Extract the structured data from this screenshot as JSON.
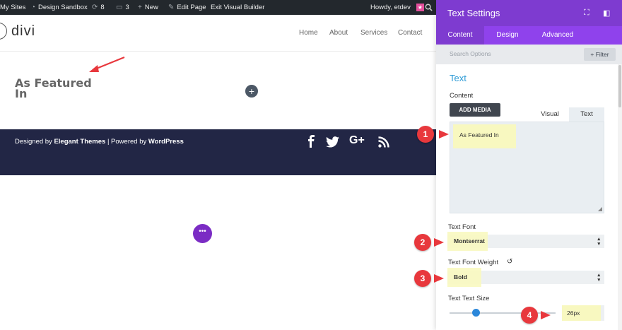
{
  "admin_bar": {
    "my_sites": "My Sites",
    "site_name": "Design Sandbox",
    "updates_count": "8",
    "comments_count": "3",
    "new_label": "New",
    "edit_page": "Edit Page",
    "exit_builder": "Exit Visual Builder",
    "howdy": "Howdy, etdev"
  },
  "site": {
    "logo_text": "divi",
    "nav": [
      "Home",
      "About",
      "Services",
      "Contact"
    ]
  },
  "content": {
    "featured_line1": "As Featured",
    "featured_line2": "In"
  },
  "footer": {
    "designed_by": "Designed by",
    "elegant_themes": "Elegant Themes",
    "powered_by": "| Powered by",
    "wordpress": "WordPress",
    "social": [
      "facebook-icon",
      "twitter-icon",
      "google-plus-icon",
      "rss-icon"
    ]
  },
  "panel": {
    "title": "Text Settings",
    "tabs": [
      "Content",
      "Design",
      "Advanced"
    ],
    "active_tab": "Content",
    "search_placeholder": "Search Options",
    "filter_label": "+ Filter",
    "section_title": "Text",
    "content_label": "Content",
    "add_media": "ADD MEDIA",
    "editor_tabs": [
      "Visual",
      "Text"
    ],
    "editor_active": "Text",
    "editor_content": "As Featured In",
    "text_font_label": "Text Font",
    "text_font_value": "Montserrat",
    "font_weight_label": "Text Font Weight",
    "font_weight_value": "Bold",
    "text_size_label": "Text Text Size",
    "text_size_value": "26px"
  },
  "annotations": [
    "1",
    "2",
    "3",
    "4"
  ],
  "colors": {
    "panel_header": "#7e3bd0",
    "tab_bar": "#8f42ec",
    "footer_bg": "#222645",
    "badge": "#e8383d",
    "highlight": "#f8f8c0",
    "section_title": "#2e9bd6"
  }
}
